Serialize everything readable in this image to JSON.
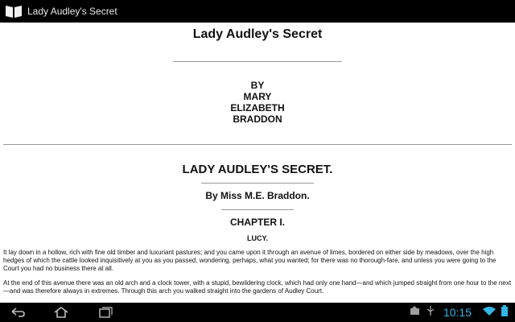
{
  "app": {
    "title": "Lady Audley's Secret"
  },
  "book": {
    "title": "Lady Audley's Secret",
    "byline": [
      "BY",
      "MARY",
      "ELIZABETH",
      "BRADDON"
    ],
    "title_caps": "LADY AUDLEY'S SECRET.",
    "author_line": "By Miss M.E. Braddon.",
    "chapter": "CHAPTER I.",
    "subheading": "LUCY.",
    "paragraphs": [
      "It lay down in a hollow, rich with fine old timber and luxuriant pastures; and you came upon it through an avenue of limes, bordered on either side by meadows, over the high hedges of which the cattle looked inquisitively at you as you passed, wondering, perhaps, what you wanted; for there was no thorough-fare, and unless you were going to the Court you had no business there at all.",
      "At the end of this avenue there was an old arch and a clock tower, with a stupid, bewildering clock, which had only one hand—and which jumped straight from one hour to the next—and was therefore always in extremes. Through this arch you walked straight into the gardens of Audley Court."
    ]
  },
  "status": {
    "time": "10:15"
  },
  "icons": {
    "app": "book-icon",
    "back": "back-arrow-icon",
    "home": "home-icon",
    "recents": "recent-apps-icon",
    "notification": "notification-icon",
    "usb": "usb-icon",
    "wifi": "wifi-icon",
    "battery": "battery-icon"
  },
  "colors": {
    "bars": "#000000",
    "clock": "#33b5e5",
    "text": "#111111"
  }
}
